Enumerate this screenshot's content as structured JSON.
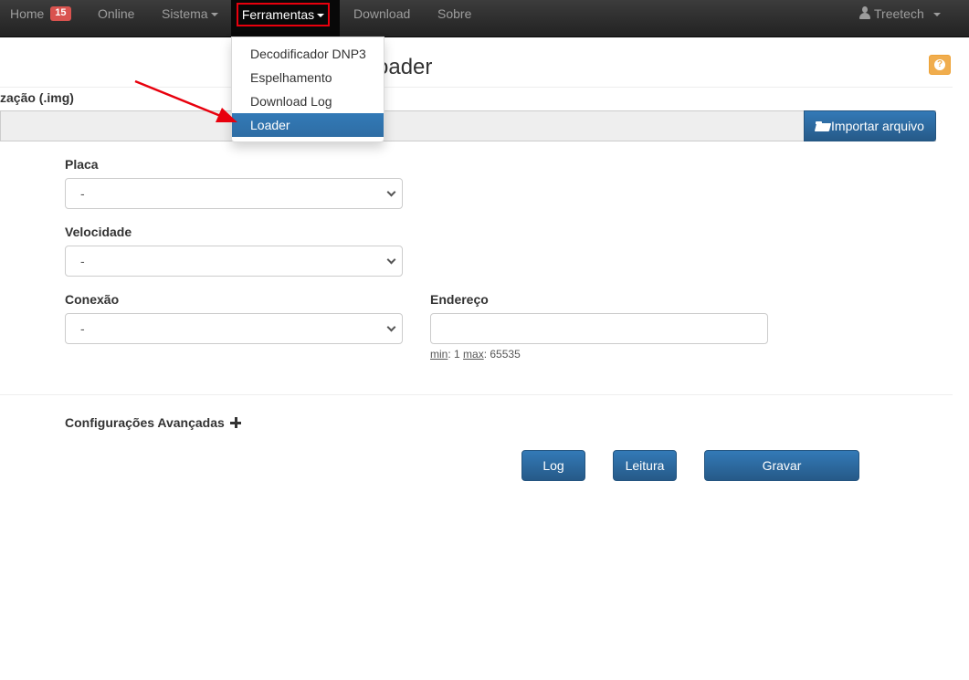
{
  "navbar": {
    "home_label": "Home",
    "home_badge": "15",
    "online_label": "Online",
    "sistema_label": "Sistema",
    "ferramentas_label": "Ferramentas",
    "download_label": "Download",
    "sobre_label": "Sobre",
    "user_label": "Treetech"
  },
  "dropdown": {
    "items": [
      {
        "label": "Decodificador DNP3"
      },
      {
        "label": "Espelhamento"
      },
      {
        "label": "Download Log"
      },
      {
        "label": "Loader",
        "active": true
      }
    ]
  },
  "page": {
    "title_visible": "oader",
    "help_icon": "question-icon",
    "section_label": "zação (.img)",
    "import_button": "Importar arquivo",
    "import_icon": "folder-open-icon"
  },
  "form": {
    "placa": {
      "label": "Placa",
      "value": "-"
    },
    "velocidade": {
      "label": "Velocidade",
      "value": "-"
    },
    "conexao": {
      "label": "Conexão",
      "value": "-"
    },
    "endereco": {
      "label": "Endereço",
      "value": "",
      "hint_min_label": "min",
      "hint_min_value": ": 1 ",
      "hint_max_label": "max",
      "hint_max_value": ": 65535"
    },
    "advanced_label": "Configurações Avançadas"
  },
  "buttons": {
    "log": "Log",
    "leitura": "Leitura",
    "gravar": "Gravar"
  },
  "colors": {
    "navbar_bg": "#222222",
    "primary": "#337ab7",
    "highlight_border": "#e8000d",
    "arrow": "#e8000d",
    "help_button": "#f0ad4e",
    "badge": "#d9534f"
  }
}
